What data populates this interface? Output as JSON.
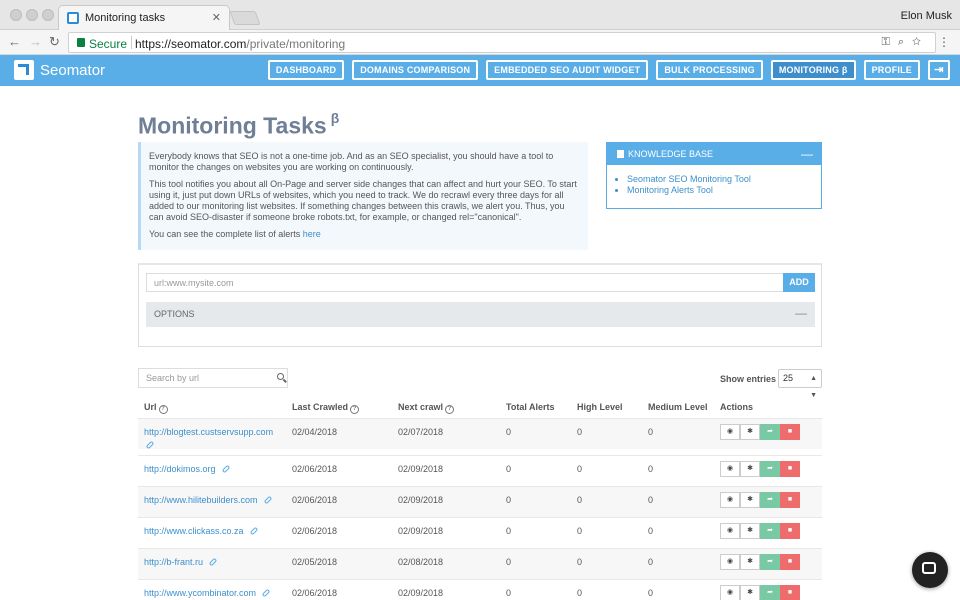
{
  "browser": {
    "tab_title": "Monitoring tasks",
    "user": "Elon Musk",
    "secure_label": "Secure",
    "url_scheme": "https://",
    "url_host": "seomator.com",
    "url_path": "/private/monitoring"
  },
  "header": {
    "logo": "Seomator",
    "nav": [
      {
        "label": "DASHBOARD"
      },
      {
        "label": "DOMAINS COMPARISON"
      },
      {
        "label": "EMBEDDED SEO AUDIT WIDGET"
      },
      {
        "label": "BULK PROCESSING"
      },
      {
        "label": "MONITORING β",
        "active": true
      },
      {
        "label": "PROFILE"
      }
    ]
  },
  "page": {
    "title": "Monitoring Tasks",
    "title_sup": "β"
  },
  "intro": {
    "p1": "Everybody knows that SEO is not a one-time job. And as an SEO specialist, you should have a tool to monitor the changes on websites you are working on continuously.",
    "p2": "This tool notifies you about all On-Page and server side changes that can affect and hurt your SEO. To start using it, just put down URLs of websites, which you need to track. We do recrawl every three days for all added to our monitoring list websites. If something changes between this crawls, we alert you. Thus, you can avoid SEO-disaster if someone broke robots.txt, for example, or changed rel=\"canonical\".",
    "p3": "You can see the complete list of alerts",
    "p3_link": "here"
  },
  "knowledge_base": {
    "title": "KNOWLEDGE BASE",
    "links": [
      "Seomator SEO Monitoring Tool",
      "Monitoring Alerts Tool"
    ]
  },
  "add_form": {
    "placeholder": "url:www.mysite.com",
    "add_label": "ADD",
    "options_label": "OPTIONS"
  },
  "table": {
    "search_placeholder": "Search by url",
    "show_entries_label": "Show entries",
    "entries_value": "25",
    "columns": {
      "url": "Url",
      "last_crawled": "Last Crawled",
      "next_crawl": "Next crawl",
      "total_alerts": "Total Alerts",
      "high_level": "High Level",
      "medium_level": "Medium Level",
      "actions": "Actions"
    },
    "rows": [
      {
        "url": "http://blogtest.custservsupp.com",
        "last": "02/04/2018",
        "next": "02/07/2018",
        "total": "0",
        "high": "0",
        "medium": "0"
      },
      {
        "url": "http://dokimos.org",
        "last": "02/06/2018",
        "next": "02/09/2018",
        "total": "0",
        "high": "0",
        "medium": "0"
      },
      {
        "url": "http://www.hilitebuilders.com",
        "last": "02/06/2018",
        "next": "02/09/2018",
        "total": "0",
        "high": "0",
        "medium": "0"
      },
      {
        "url": "http://www.clickass.co.za",
        "last": "02/06/2018",
        "next": "02/09/2018",
        "total": "0",
        "high": "0",
        "medium": "0"
      },
      {
        "url": "http://b-frant.ru",
        "last": "02/05/2018",
        "next": "02/08/2018",
        "total": "0",
        "high": "0",
        "medium": "0"
      },
      {
        "url": "http://www.ycombinator.com",
        "last": "02/06/2018",
        "next": "02/09/2018",
        "total": "0",
        "high": "0",
        "medium": "0"
      }
    ]
  },
  "icons": {
    "view": "eye-icon",
    "settings": "gear-icon",
    "share": "share-icon",
    "delete": "trash-icon",
    "chat": "chat-icon"
  }
}
